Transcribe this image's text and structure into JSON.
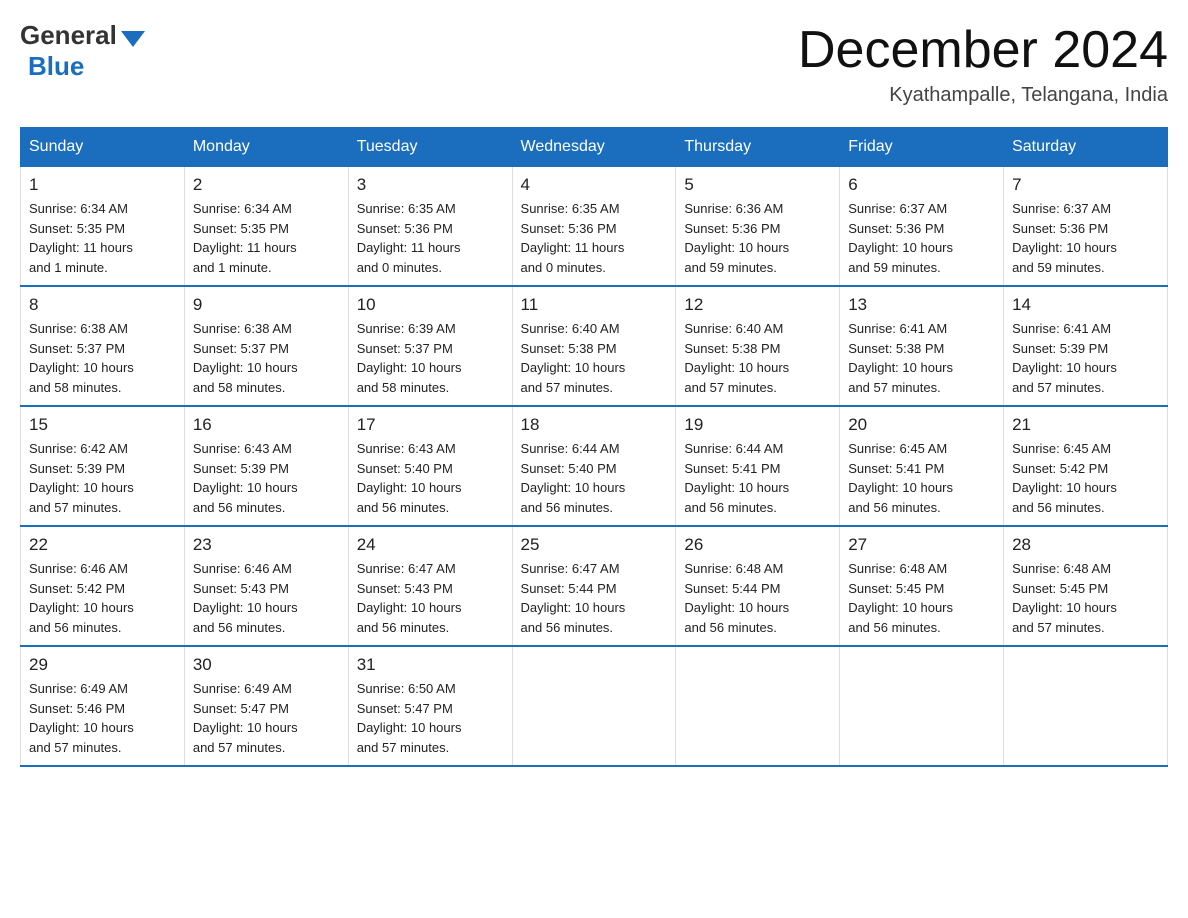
{
  "header": {
    "logo_general": "General",
    "logo_blue": "Blue",
    "title": "December 2024",
    "subtitle": "Kyathampalle, Telangana, India"
  },
  "days_of_week": [
    "Sunday",
    "Monday",
    "Tuesday",
    "Wednesday",
    "Thursday",
    "Friday",
    "Saturday"
  ],
  "weeks": [
    [
      {
        "day": "1",
        "sunrise": "6:34 AM",
        "sunset": "5:35 PM",
        "daylight": "11 hours and 1 minute."
      },
      {
        "day": "2",
        "sunrise": "6:34 AM",
        "sunset": "5:35 PM",
        "daylight": "11 hours and 1 minute."
      },
      {
        "day": "3",
        "sunrise": "6:35 AM",
        "sunset": "5:36 PM",
        "daylight": "11 hours and 0 minutes."
      },
      {
        "day": "4",
        "sunrise": "6:35 AM",
        "sunset": "5:36 PM",
        "daylight": "11 hours and 0 minutes."
      },
      {
        "day": "5",
        "sunrise": "6:36 AM",
        "sunset": "5:36 PM",
        "daylight": "10 hours and 59 minutes."
      },
      {
        "day": "6",
        "sunrise": "6:37 AM",
        "sunset": "5:36 PM",
        "daylight": "10 hours and 59 minutes."
      },
      {
        "day": "7",
        "sunrise": "6:37 AM",
        "sunset": "5:36 PM",
        "daylight": "10 hours and 59 minutes."
      }
    ],
    [
      {
        "day": "8",
        "sunrise": "6:38 AM",
        "sunset": "5:37 PM",
        "daylight": "10 hours and 58 minutes."
      },
      {
        "day": "9",
        "sunrise": "6:38 AM",
        "sunset": "5:37 PM",
        "daylight": "10 hours and 58 minutes."
      },
      {
        "day": "10",
        "sunrise": "6:39 AM",
        "sunset": "5:37 PM",
        "daylight": "10 hours and 58 minutes."
      },
      {
        "day": "11",
        "sunrise": "6:40 AM",
        "sunset": "5:38 PM",
        "daylight": "10 hours and 57 minutes."
      },
      {
        "day": "12",
        "sunrise": "6:40 AM",
        "sunset": "5:38 PM",
        "daylight": "10 hours and 57 minutes."
      },
      {
        "day": "13",
        "sunrise": "6:41 AM",
        "sunset": "5:38 PM",
        "daylight": "10 hours and 57 minutes."
      },
      {
        "day": "14",
        "sunrise": "6:41 AM",
        "sunset": "5:39 PM",
        "daylight": "10 hours and 57 minutes."
      }
    ],
    [
      {
        "day": "15",
        "sunrise": "6:42 AM",
        "sunset": "5:39 PM",
        "daylight": "10 hours and 57 minutes."
      },
      {
        "day": "16",
        "sunrise": "6:43 AM",
        "sunset": "5:39 PM",
        "daylight": "10 hours and 56 minutes."
      },
      {
        "day": "17",
        "sunrise": "6:43 AM",
        "sunset": "5:40 PM",
        "daylight": "10 hours and 56 minutes."
      },
      {
        "day": "18",
        "sunrise": "6:44 AM",
        "sunset": "5:40 PM",
        "daylight": "10 hours and 56 minutes."
      },
      {
        "day": "19",
        "sunrise": "6:44 AM",
        "sunset": "5:41 PM",
        "daylight": "10 hours and 56 minutes."
      },
      {
        "day": "20",
        "sunrise": "6:45 AM",
        "sunset": "5:41 PM",
        "daylight": "10 hours and 56 minutes."
      },
      {
        "day": "21",
        "sunrise": "6:45 AM",
        "sunset": "5:42 PM",
        "daylight": "10 hours and 56 minutes."
      }
    ],
    [
      {
        "day": "22",
        "sunrise": "6:46 AM",
        "sunset": "5:42 PM",
        "daylight": "10 hours and 56 minutes."
      },
      {
        "day": "23",
        "sunrise": "6:46 AM",
        "sunset": "5:43 PM",
        "daylight": "10 hours and 56 minutes."
      },
      {
        "day": "24",
        "sunrise": "6:47 AM",
        "sunset": "5:43 PM",
        "daylight": "10 hours and 56 minutes."
      },
      {
        "day": "25",
        "sunrise": "6:47 AM",
        "sunset": "5:44 PM",
        "daylight": "10 hours and 56 minutes."
      },
      {
        "day": "26",
        "sunrise": "6:48 AM",
        "sunset": "5:44 PM",
        "daylight": "10 hours and 56 minutes."
      },
      {
        "day": "27",
        "sunrise": "6:48 AM",
        "sunset": "5:45 PM",
        "daylight": "10 hours and 56 minutes."
      },
      {
        "day": "28",
        "sunrise": "6:48 AM",
        "sunset": "5:45 PM",
        "daylight": "10 hours and 57 minutes."
      }
    ],
    [
      {
        "day": "29",
        "sunrise": "6:49 AM",
        "sunset": "5:46 PM",
        "daylight": "10 hours and 57 minutes."
      },
      {
        "day": "30",
        "sunrise": "6:49 AM",
        "sunset": "5:47 PM",
        "daylight": "10 hours and 57 minutes."
      },
      {
        "day": "31",
        "sunrise": "6:50 AM",
        "sunset": "5:47 PM",
        "daylight": "10 hours and 57 minutes."
      },
      null,
      null,
      null,
      null
    ]
  ],
  "labels": {
    "sunrise": "Sunrise:",
    "sunset": "Sunset:",
    "daylight": "Daylight:"
  }
}
